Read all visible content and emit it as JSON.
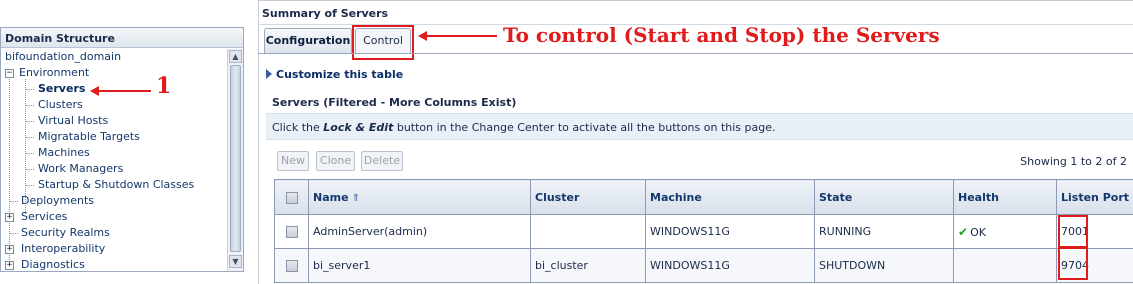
{
  "domain_structure": {
    "title": "Domain Structure",
    "root": "bifoundation_domain",
    "items": [
      {
        "label": "Environment",
        "expander": "−"
      },
      {
        "label": "Servers"
      },
      {
        "label": "Clusters"
      },
      {
        "label": "Virtual Hosts"
      },
      {
        "label": "Migratable Targets"
      },
      {
        "label": "Machines"
      },
      {
        "label": "Work Managers"
      },
      {
        "label": "Startup & Shutdown Classes"
      },
      {
        "label": "Deployments"
      },
      {
        "label": "Services",
        "expander": "+"
      },
      {
        "label": "Security Realms"
      },
      {
        "label": "Interoperability",
        "expander": "+"
      },
      {
        "label": "Diagnostics",
        "expander": "+"
      }
    ],
    "annotation": "1"
  },
  "main": {
    "title": "Summary of Servers",
    "tabs": [
      {
        "label": "Configuration",
        "selected": true
      },
      {
        "label": "Control",
        "selected": false
      }
    ],
    "tab_annotation": "To control (Start and Stop) the Servers",
    "customize_link": "Customize this table",
    "table_title": "Servers (Filtered - More Columns Exist)",
    "info": {
      "prefix": "Click the ",
      "emphasis": "Lock & Edit",
      "suffix": " button in the Change Center to activate all the buttons on this page."
    },
    "buttons": {
      "new": "New",
      "clone": "Clone",
      "delete": "Delete"
    },
    "showing": "Showing 1 to 2 of 2",
    "columns": [
      "Name",
      "Cluster",
      "Machine",
      "State",
      "Health",
      "Listen Port"
    ],
    "rows": [
      {
        "name": "AdminServer(admin)",
        "cluster": "",
        "machine": "WINDOWS11G",
        "state": "RUNNING",
        "health": "OK",
        "port": "7001"
      },
      {
        "name": "bi_server1",
        "cluster": "bi_cluster",
        "machine": "WINDOWS11G",
        "state": "SHUTDOWN",
        "health": "",
        "port": "9704"
      }
    ]
  },
  "colors": {
    "annotation_red": "#e01b1b",
    "link_blue": "#14386b",
    "ok_green": "#2a9d2a"
  }
}
